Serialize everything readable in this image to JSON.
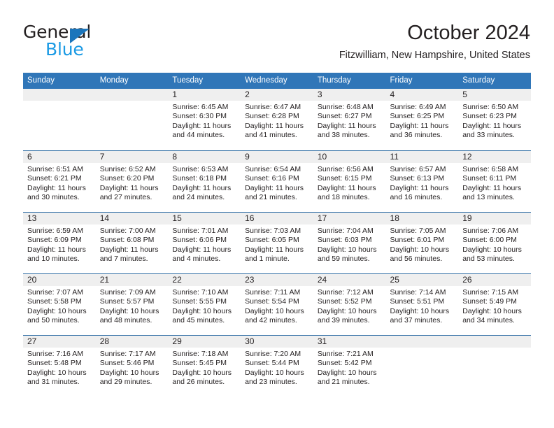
{
  "brand": {
    "name_part1": "General",
    "name_part2": "Blue",
    "triangle_icon": "triangle-icon",
    "accent_color": "#1b75bb",
    "blue_color": "#1b9ae4"
  },
  "header": {
    "title": "October 2024",
    "subtitle": "Fitzwilliam, New Hampshire, United States",
    "header_bg_color": "#3076b8",
    "daynum_bg_color": "#efefef",
    "row_line_color": "#2e6da4"
  },
  "weekday_headers": [
    "Sunday",
    "Monday",
    "Tuesday",
    "Wednesday",
    "Thursday",
    "Friday",
    "Saturday"
  ],
  "labels": {
    "sunrise": "Sunrise:",
    "sunset": "Sunset:",
    "daylight": "Daylight:"
  },
  "weeks": [
    [
      {
        "day": "",
        "sunrise": "",
        "sunset": "",
        "daylight": ""
      },
      {
        "day": "",
        "sunrise": "",
        "sunset": "",
        "daylight": ""
      },
      {
        "day": "1",
        "sunrise": "Sunrise: 6:45 AM",
        "sunset": "Sunset: 6:30 PM",
        "daylight": "Daylight: 11 hours and 44 minutes."
      },
      {
        "day": "2",
        "sunrise": "Sunrise: 6:47 AM",
        "sunset": "Sunset: 6:28 PM",
        "daylight": "Daylight: 11 hours and 41 minutes."
      },
      {
        "day": "3",
        "sunrise": "Sunrise: 6:48 AM",
        "sunset": "Sunset: 6:27 PM",
        "daylight": "Daylight: 11 hours and 38 minutes."
      },
      {
        "day": "4",
        "sunrise": "Sunrise: 6:49 AM",
        "sunset": "Sunset: 6:25 PM",
        "daylight": "Daylight: 11 hours and 36 minutes."
      },
      {
        "day": "5",
        "sunrise": "Sunrise: 6:50 AM",
        "sunset": "Sunset: 6:23 PM",
        "daylight": "Daylight: 11 hours and 33 minutes."
      }
    ],
    [
      {
        "day": "6",
        "sunrise": "Sunrise: 6:51 AM",
        "sunset": "Sunset: 6:21 PM",
        "daylight": "Daylight: 11 hours and 30 minutes."
      },
      {
        "day": "7",
        "sunrise": "Sunrise: 6:52 AM",
        "sunset": "Sunset: 6:20 PM",
        "daylight": "Daylight: 11 hours and 27 minutes."
      },
      {
        "day": "8",
        "sunrise": "Sunrise: 6:53 AM",
        "sunset": "Sunset: 6:18 PM",
        "daylight": "Daylight: 11 hours and 24 minutes."
      },
      {
        "day": "9",
        "sunrise": "Sunrise: 6:54 AM",
        "sunset": "Sunset: 6:16 PM",
        "daylight": "Daylight: 11 hours and 21 minutes."
      },
      {
        "day": "10",
        "sunrise": "Sunrise: 6:56 AM",
        "sunset": "Sunset: 6:15 PM",
        "daylight": "Daylight: 11 hours and 18 minutes."
      },
      {
        "day": "11",
        "sunrise": "Sunrise: 6:57 AM",
        "sunset": "Sunset: 6:13 PM",
        "daylight": "Daylight: 11 hours and 16 minutes."
      },
      {
        "day": "12",
        "sunrise": "Sunrise: 6:58 AM",
        "sunset": "Sunset: 6:11 PM",
        "daylight": "Daylight: 11 hours and 13 minutes."
      }
    ],
    [
      {
        "day": "13",
        "sunrise": "Sunrise: 6:59 AM",
        "sunset": "Sunset: 6:09 PM",
        "daylight": "Daylight: 11 hours and 10 minutes."
      },
      {
        "day": "14",
        "sunrise": "Sunrise: 7:00 AM",
        "sunset": "Sunset: 6:08 PM",
        "daylight": "Daylight: 11 hours and 7 minutes."
      },
      {
        "day": "15",
        "sunrise": "Sunrise: 7:01 AM",
        "sunset": "Sunset: 6:06 PM",
        "daylight": "Daylight: 11 hours and 4 minutes."
      },
      {
        "day": "16",
        "sunrise": "Sunrise: 7:03 AM",
        "sunset": "Sunset: 6:05 PM",
        "daylight": "Daylight: 11 hours and 1 minute."
      },
      {
        "day": "17",
        "sunrise": "Sunrise: 7:04 AM",
        "sunset": "Sunset: 6:03 PM",
        "daylight": "Daylight: 10 hours and 59 minutes."
      },
      {
        "day": "18",
        "sunrise": "Sunrise: 7:05 AM",
        "sunset": "Sunset: 6:01 PM",
        "daylight": "Daylight: 10 hours and 56 minutes."
      },
      {
        "day": "19",
        "sunrise": "Sunrise: 7:06 AM",
        "sunset": "Sunset: 6:00 PM",
        "daylight": "Daylight: 10 hours and 53 minutes."
      }
    ],
    [
      {
        "day": "20",
        "sunrise": "Sunrise: 7:07 AM",
        "sunset": "Sunset: 5:58 PM",
        "daylight": "Daylight: 10 hours and 50 minutes."
      },
      {
        "day": "21",
        "sunrise": "Sunrise: 7:09 AM",
        "sunset": "Sunset: 5:57 PM",
        "daylight": "Daylight: 10 hours and 48 minutes."
      },
      {
        "day": "22",
        "sunrise": "Sunrise: 7:10 AM",
        "sunset": "Sunset: 5:55 PM",
        "daylight": "Daylight: 10 hours and 45 minutes."
      },
      {
        "day": "23",
        "sunrise": "Sunrise: 7:11 AM",
        "sunset": "Sunset: 5:54 PM",
        "daylight": "Daylight: 10 hours and 42 minutes."
      },
      {
        "day": "24",
        "sunrise": "Sunrise: 7:12 AM",
        "sunset": "Sunset: 5:52 PM",
        "daylight": "Daylight: 10 hours and 39 minutes."
      },
      {
        "day": "25",
        "sunrise": "Sunrise: 7:14 AM",
        "sunset": "Sunset: 5:51 PM",
        "daylight": "Daylight: 10 hours and 37 minutes."
      },
      {
        "day": "26",
        "sunrise": "Sunrise: 7:15 AM",
        "sunset": "Sunset: 5:49 PM",
        "daylight": "Daylight: 10 hours and 34 minutes."
      }
    ],
    [
      {
        "day": "27",
        "sunrise": "Sunrise: 7:16 AM",
        "sunset": "Sunset: 5:48 PM",
        "daylight": "Daylight: 10 hours and 31 minutes."
      },
      {
        "day": "28",
        "sunrise": "Sunrise: 7:17 AM",
        "sunset": "Sunset: 5:46 PM",
        "daylight": "Daylight: 10 hours and 29 minutes."
      },
      {
        "day": "29",
        "sunrise": "Sunrise: 7:18 AM",
        "sunset": "Sunset: 5:45 PM",
        "daylight": "Daylight: 10 hours and 26 minutes."
      },
      {
        "day": "30",
        "sunrise": "Sunrise: 7:20 AM",
        "sunset": "Sunset: 5:44 PM",
        "daylight": "Daylight: 10 hours and 23 minutes."
      },
      {
        "day": "31",
        "sunrise": "Sunrise: 7:21 AM",
        "sunset": "Sunset: 5:42 PM",
        "daylight": "Daylight: 10 hours and 21 minutes."
      },
      {
        "day": "",
        "sunrise": "",
        "sunset": "",
        "daylight": ""
      },
      {
        "day": "",
        "sunrise": "",
        "sunset": "",
        "daylight": ""
      }
    ]
  ]
}
